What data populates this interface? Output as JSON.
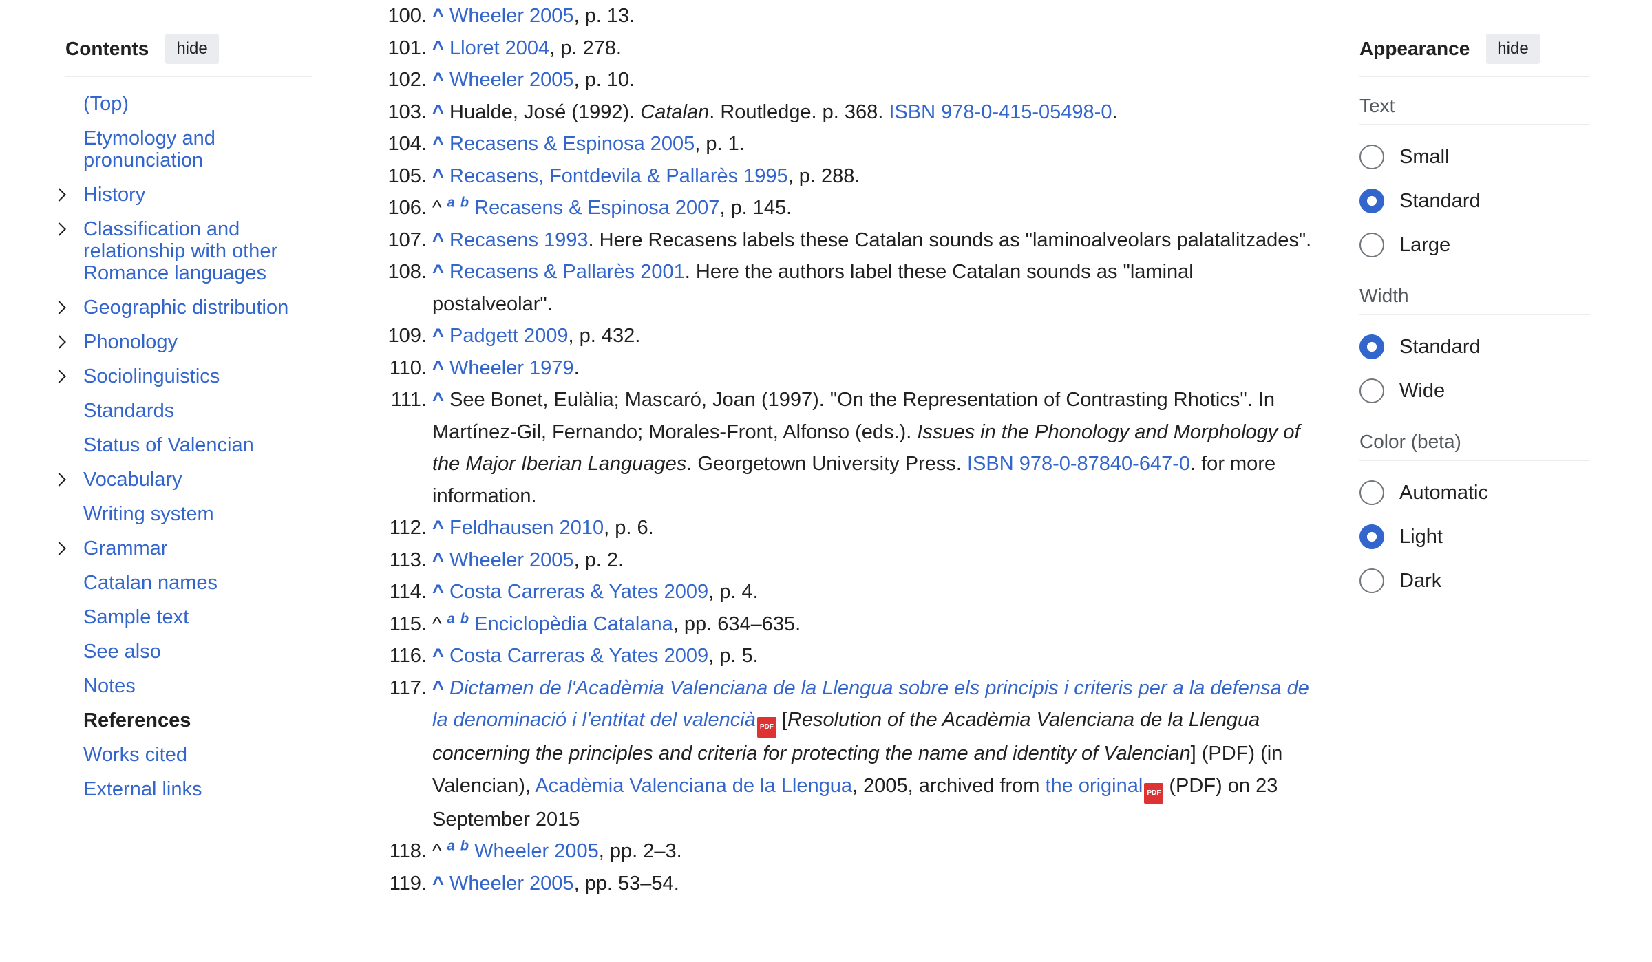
{
  "toc": {
    "title": "Contents",
    "hide_label": "hide",
    "items": [
      {
        "label": "(Top)",
        "expandable": false,
        "bold": false
      },
      {
        "label": "Etymology and pronunciation",
        "expandable": false,
        "bold": false
      },
      {
        "label": "History",
        "expandable": true,
        "bold": false
      },
      {
        "label": "Classification and relationship with other Romance languages",
        "expandable": true,
        "bold": false
      },
      {
        "label": "Geographic distribution",
        "expandable": true,
        "bold": false
      },
      {
        "label": "Phonology",
        "expandable": true,
        "bold": false
      },
      {
        "label": "Sociolinguistics",
        "expandable": true,
        "bold": false
      },
      {
        "label": "Standards",
        "expandable": false,
        "bold": false
      },
      {
        "label": "Status of Valencian",
        "expandable": false,
        "bold": false
      },
      {
        "label": "Vocabulary",
        "expandable": true,
        "bold": false
      },
      {
        "label": "Writing system",
        "expandable": false,
        "bold": false
      },
      {
        "label": "Grammar",
        "expandable": true,
        "bold": false
      },
      {
        "label": "Catalan names",
        "expandable": false,
        "bold": false
      },
      {
        "label": "Sample text",
        "expandable": false,
        "bold": false
      },
      {
        "label": "See also",
        "expandable": false,
        "bold": false
      },
      {
        "label": "Notes",
        "expandable": false,
        "bold": false
      },
      {
        "label": "References",
        "expandable": false,
        "bold": true
      },
      {
        "label": "Works cited",
        "expandable": false,
        "bold": false
      },
      {
        "label": "External links",
        "expandable": false,
        "bold": false
      }
    ]
  },
  "refs": {
    "r100": {
      "num": "100.",
      "caret": "^",
      "link": "Wheeler 2005",
      "rest": ", p. 13."
    },
    "r101": {
      "num": "101.",
      "caret": "^",
      "link": "Lloret 2004",
      "rest": ", p. 278."
    },
    "r102": {
      "num": "102.",
      "caret": "^",
      "link": "Wheeler 2005",
      "rest": ", p. 10."
    },
    "r103": {
      "num": "103.",
      "caret": "^",
      "pre": " Hualde, José (1992). ",
      "title": "Catalan",
      "mid": ". Routledge. p. 368. ",
      "isbn": "ISBN 978-0-415-05498-0",
      "end": "."
    },
    "r104": {
      "num": "104.",
      "caret": "^",
      "link": "Recasens & Espinosa 2005",
      "rest": ", p. 1."
    },
    "r105": {
      "num": "105.",
      "caret": "^",
      "link": "Recasens, Fontdevila & Pallarès 1995",
      "rest": ", p. 288."
    },
    "r106": {
      "num": "106.",
      "caret": "^",
      "a": "a",
      "b": "b",
      "link": "Recasens & Espinosa 2007",
      "rest": ", p. 145."
    },
    "r107": {
      "num": "107.",
      "caret": "^",
      "link": "Recasens 1993",
      "rest": ". Here Recasens labels these Catalan sounds as \"laminoalveolars palatalitzades\"."
    },
    "r108": {
      "num": "108.",
      "caret": "^",
      "link": "Recasens & Pallarès 2001",
      "rest": ". Here the authors label these Catalan sounds as \"laminal postalveolar\"."
    },
    "r109": {
      "num": "109.",
      "caret": "^",
      "link": "Padgett 2009",
      "rest": ", p. 432."
    },
    "r110": {
      "num": "110.",
      "caret": "^",
      "link": "Wheeler 1979",
      "rest": "."
    },
    "r111": {
      "num": "111.",
      "caret": "^",
      "pre": " See Bonet, Eulàlia; Mascaró, Joan (1997). \"On the Representation of Contrasting Rhotics\". In Martínez-Gil, Fernando; Morales-Front, Alfonso (eds.). ",
      "title": "Issues in the Phonology and Morphology of the Major Iberian Languages",
      "mid": ". Georgetown University Press. ",
      "isbn": "ISBN 978-0-87840-647-0",
      "end": ". for more information."
    },
    "r112": {
      "num": "112.",
      "caret": "^",
      "link": "Feldhausen 2010",
      "rest": ", p. 6."
    },
    "r113": {
      "num": "113.",
      "caret": "^",
      "link": "Wheeler 2005",
      "rest": ", p. 2."
    },
    "r114": {
      "num": "114.",
      "caret": "^",
      "link": "Costa Carreras & Yates 2009",
      "rest": ", p. 4."
    },
    "r115": {
      "num": "115.",
      "caret": "^",
      "a": "a",
      "b": "b",
      "link": "Enciclopèdia Catalana",
      "rest": ", pp. 634–635."
    },
    "r116": {
      "num": "116.",
      "caret": "^",
      "link": "Costa Carreras & Yates 2009",
      "rest": ", p. 5."
    },
    "r117": {
      "num": "117.",
      "caret": "^",
      "title_link": "Dictamen de l'Acadèmia Valenciana de la Llengua sobre els principis i criteris per a la defensa de la denominació i l'entitat del valencià",
      "bracket_open": " [",
      "translation": "Resolution of the Acadèmia Valenciana de la Llengua concerning the principles and criteria for protecting the name and identity of Valencian",
      "bracket_close": "] (PDF) (in Valencian), ",
      "publisher": "Acadèmia Valenciana de la Llengua",
      "mid": ", 2005, archived from ",
      "original": "the original",
      "end": " (PDF) on 23 September 2015",
      "pdf_icon": "pdf-icon"
    },
    "r118": {
      "num": "118.",
      "caret": "^",
      "a": "a",
      "b": "b",
      "link": "Wheeler 2005",
      "rest": ", pp. 2–3."
    },
    "r119": {
      "num": "119.",
      "caret": "^",
      "link": "Wheeler 2005",
      "rest": ", pp. 53–54."
    }
  },
  "appearance": {
    "title": "Appearance",
    "hide_label": "hide",
    "text_label": "Text",
    "text_options": [
      "Small",
      "Standard",
      "Large"
    ],
    "text_selected": "Standard",
    "width_label": "Width",
    "width_options": [
      "Standard",
      "Wide"
    ],
    "width_selected": "Standard",
    "color_label": "Color (beta)",
    "color_options": [
      "Automatic",
      "Light",
      "Dark"
    ],
    "color_selected": "Light",
    "accent_color": "#3366cc"
  }
}
